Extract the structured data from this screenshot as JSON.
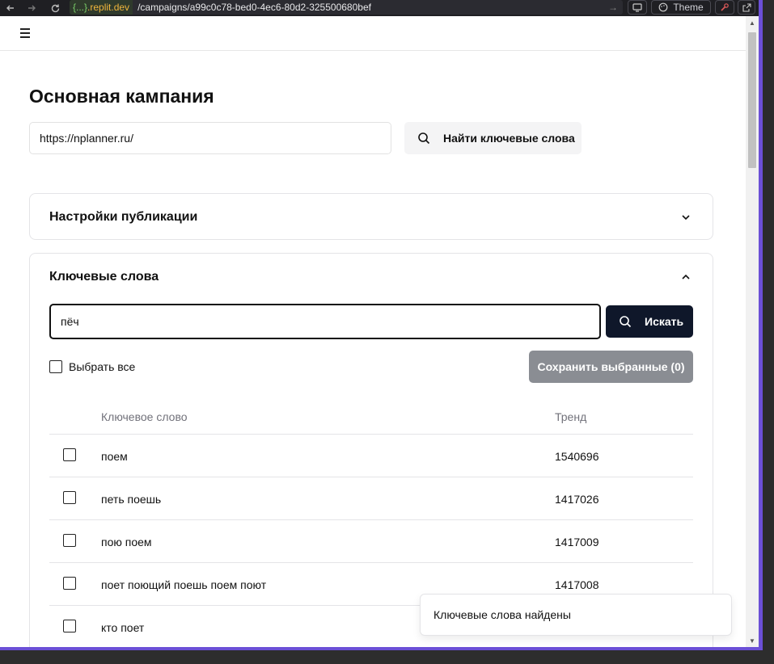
{
  "browser": {
    "domain_prefix": "{...}",
    "domain_suffix": ".replit.dev",
    "url_path": "/campaigns/a99c0c78-bed0-4ec6-80d2-325500680bef",
    "theme_label": "Theme"
  },
  "page": {
    "title": "Основная кампания",
    "site_url_value": "https://nplanner.ru/",
    "find_keywords_label": "Найти ключевые слова"
  },
  "settings_card": {
    "title": "Настройки публикации"
  },
  "keywords_card": {
    "title": "Ключевые слова",
    "search_value": "пёч",
    "search_button_label": "Искать",
    "select_all_label": "Выбрать все",
    "save_button_label": "Сохранить выбранные (0)",
    "columns": {
      "keyword": "Ключевое слово",
      "trend": "Тренд"
    },
    "rows": [
      {
        "keyword": "поем",
        "trend": "1540696"
      },
      {
        "keyword": "петь поешь",
        "trend": "1417026"
      },
      {
        "keyword": "пою поем",
        "trend": "1417009"
      },
      {
        "keyword": "поет поющий поешь поем поют",
        "trend": "1417008"
      },
      {
        "keyword": "кто поет",
        "trend": ""
      }
    ]
  },
  "toast": {
    "message": "Ключевые слова найдены"
  },
  "colors": {
    "primary_button": "#0f172a",
    "disabled_button": "#8a8d93",
    "accent_border": "#6b4fd6"
  }
}
